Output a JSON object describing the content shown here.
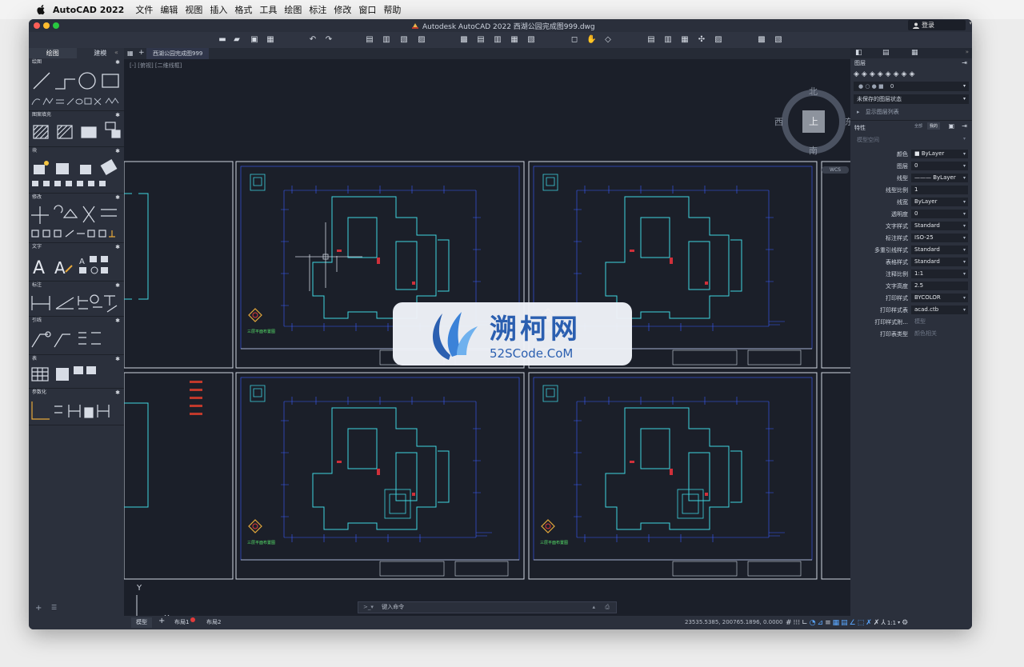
{
  "menubar": {
    "app_name": "AutoCAD 2022",
    "items": [
      "文件",
      "编辑",
      "视图",
      "插入",
      "格式",
      "工具",
      "绘图",
      "标注",
      "修改",
      "窗口",
      "帮助"
    ]
  },
  "window": {
    "title": "Autodesk AutoCAD 2022   西湖公园完成图999.dwg",
    "login_label": "登录"
  },
  "left_panel": {
    "tabs": [
      "绘图",
      "建模"
    ],
    "sections": [
      "绘图",
      "图案填充",
      "块",
      "修改",
      "文字",
      "标注",
      "引线",
      "表",
      "参数化"
    ]
  },
  "document": {
    "tab_label": "西湖公园完成图999",
    "viewport_label": "[-] [俯视] [二维线框]"
  },
  "viewcube": {
    "north": "北",
    "south": "南",
    "east": "东",
    "west": "西",
    "top_face": "上",
    "wcs_label": "WCS"
  },
  "drawing": {
    "caption_plan": "三层平面布置图",
    "caption_ceiling": "二层平面布置图",
    "north_label": "北"
  },
  "right_panel": {
    "layers_title": "图层",
    "layer_current": "0",
    "layer_state": "未保存的图层状态",
    "layer_list": "显示图层列表",
    "properties_title": "特性",
    "properties_hint": "全部",
    "properties_hint2": "我的",
    "model_space": "模型空间",
    "props": [
      {
        "label": "颜色",
        "value": "ByLayer",
        "swatch": true
      },
      {
        "label": "图层",
        "value": "0"
      },
      {
        "label": "线型",
        "value": "ByLayer",
        "line": true
      },
      {
        "label": "线型比例",
        "value": "1",
        "plain": true
      },
      {
        "label": "线宽",
        "value": "ByLayer"
      },
      {
        "label": "透明度",
        "value": "0"
      },
      {
        "label": "文字样式",
        "value": "Standard"
      },
      {
        "label": "标注样式",
        "value": "ISO-25"
      },
      {
        "label": "多重引线样式",
        "value": "Standard"
      },
      {
        "label": "表格样式",
        "value": "Standard"
      },
      {
        "label": "注释比例",
        "value": "1:1"
      },
      {
        "label": "文字高度",
        "value": "2.5",
        "plain": true
      },
      {
        "label": "打印样式",
        "value": "BYCOLOR"
      },
      {
        "label": "打印样式表",
        "value": "acad.ctb"
      },
      {
        "label": "打印样式附...",
        "value": "模型",
        "dim": true
      },
      {
        "label": "打印表类型",
        "value": "颜色相关",
        "dim": true
      }
    ]
  },
  "command": {
    "prompt": "键入命令"
  },
  "status": {
    "model_tab": "模型",
    "layout1": "布局1",
    "layout2": "布局2",
    "coordinates": "23535.5385, 200765.1896, 0.0000",
    "scale": "1:1"
  },
  "ucs": {
    "x": "X",
    "y": "Y"
  },
  "watermark": {
    "name": "溯柯网",
    "domain": "52SCode.CoM"
  },
  "colors": {
    "accent": "#2b5fb0",
    "drawing_blue": "#3a5cff",
    "drawing_cyan": "#3fd4e0"
  }
}
